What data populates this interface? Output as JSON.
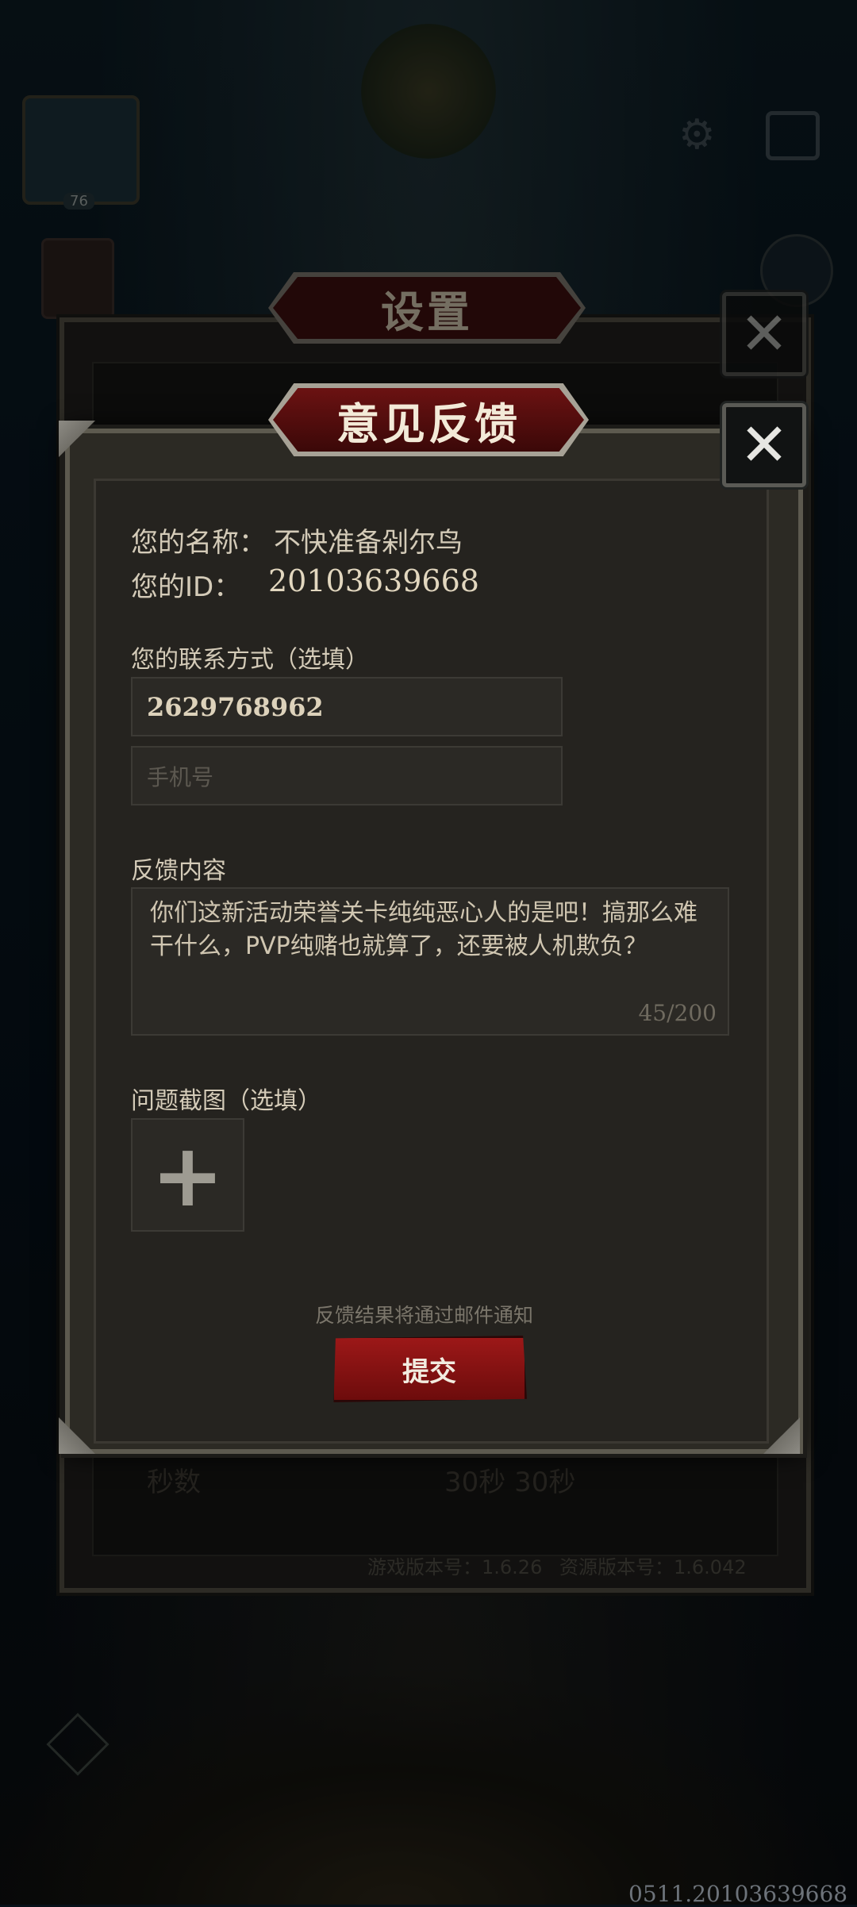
{
  "settings": {
    "title": "设置",
    "row_label": "秒数",
    "row_values": "30秒     30秒",
    "game_version": "游戏版本号：1.6.26",
    "resource_version": "资源版本号：1.6.042"
  },
  "feedback": {
    "title": "意见反馈",
    "name_label": "您的名称：",
    "name_value": "不快准备剁尔鸟",
    "id_label": "您的ID：",
    "id_value": "20103639668",
    "contact_label": "您的联系方式（选填）",
    "contact_value": "2629768962",
    "phone_placeholder": "手机号",
    "content_label": "反馈内容",
    "content_text": "你们这新活动荣誉关卡纯纯恶心人的是吧！搞那么难干什么，PVP纯赌也就算了，还要被人机欺负？",
    "char_count": "45/200",
    "screenshot_label": "问题截图（选填）",
    "notice": "反馈结果将通过邮件通知",
    "submit_label": "提交"
  },
  "avatar_level": "76",
  "footer_id": "0511.20103639668",
  "icons": {
    "close": "close-icon",
    "add": "plus-icon",
    "settings": "gear-icon",
    "mail": "mail-icon"
  },
  "colors": {
    "accent_red": "#8a1212",
    "text_gold": "#d4cbb8",
    "frame": "#5d5a4f"
  }
}
